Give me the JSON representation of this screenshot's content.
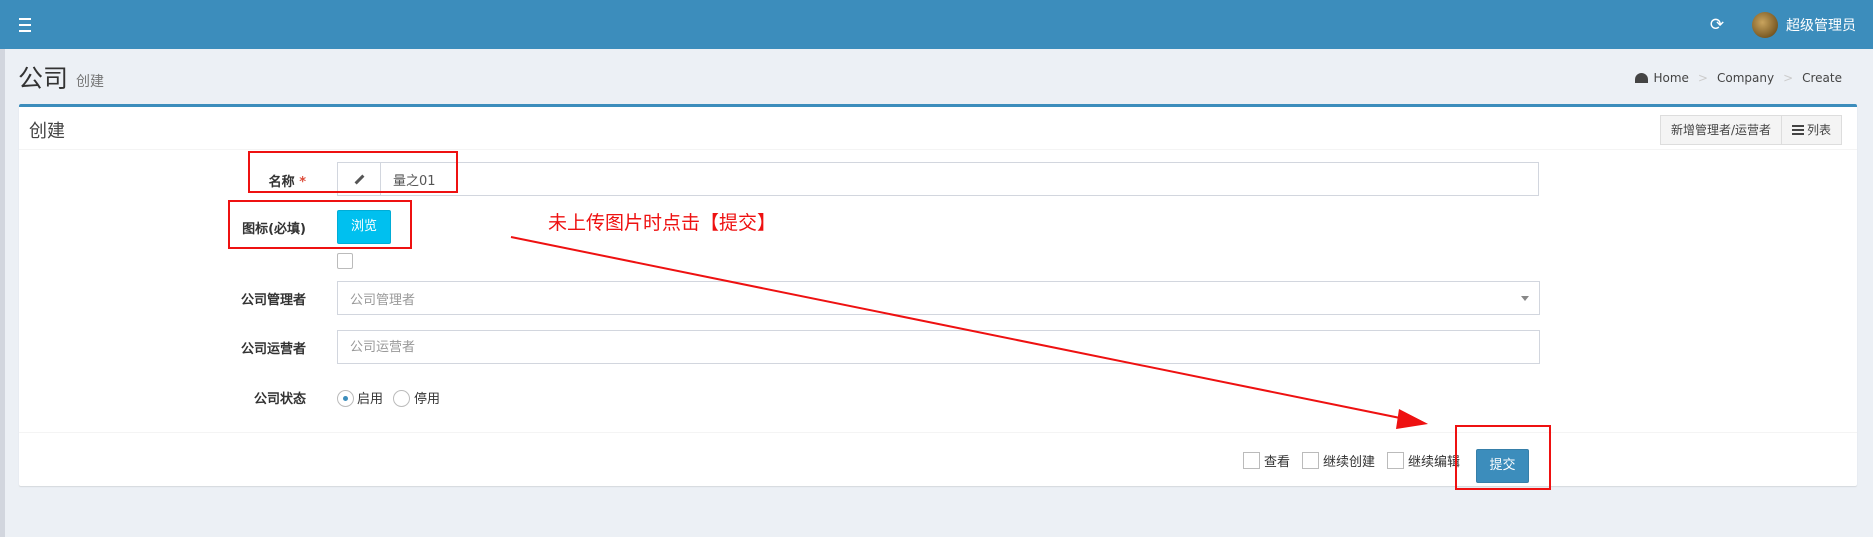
{
  "navbar": {
    "menu_icon": "hamburger-icon",
    "refresh_icon": "refresh-icon",
    "username": "超级管理员"
  },
  "header": {
    "title": "公司",
    "subtitle": "创建",
    "breadcrumb": {
      "icon": "dashboard-icon",
      "items": [
        "Home",
        "Company",
        "Create"
      ],
      "separator": ">"
    }
  },
  "box": {
    "title": "创建",
    "tools": {
      "add_manager_label": "新增管理者/运营者",
      "list_label": "列表"
    }
  },
  "form": {
    "name": {
      "label": "名称",
      "required_mark": "*",
      "icon": "pencil-icon",
      "value": "量之01"
    },
    "icon_field": {
      "label": "图标(必填)",
      "browse_label": "浏览"
    },
    "manager": {
      "label": "公司管理者",
      "placeholder": "公司管理者"
    },
    "operator": {
      "label": "公司运营者",
      "placeholder": "公司运营者"
    },
    "status": {
      "label": "公司状态",
      "options": [
        {
          "label": "启用",
          "checked": true
        },
        {
          "label": "停用",
          "checked": false
        }
      ]
    }
  },
  "footer": {
    "checks": [
      "查看",
      "继续创建",
      "继续编辑"
    ],
    "submit_label": "提交"
  },
  "annotation": {
    "text": "未上传图片时点击【提交】",
    "color": "#ee1111"
  },
  "colors": {
    "navbar": "#3c8dbc",
    "browse_button": "#00c0ef",
    "submit_button": "#3c8dbc"
  }
}
